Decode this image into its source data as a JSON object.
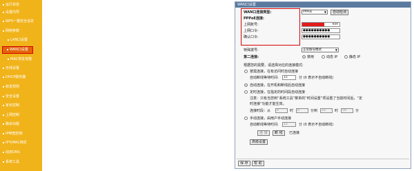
{
  "sidebar": {
    "items": [
      {
        "label": "运行状态"
      },
      {
        "label": "设置向导"
      },
      {
        "label": "WPS一键安全设定"
      },
      {
        "label": "网络参数"
      },
      {
        "label": "LAN口设置"
      },
      {
        "label": "WAN口设置"
      },
      {
        "label": "MAC地址克隆"
      },
      {
        "label": "无线设置"
      },
      {
        "label": "DHCP服务器"
      },
      {
        "label": "转发规则"
      },
      {
        "label": "安全设置"
      },
      {
        "label": "家长控制"
      },
      {
        "label": "上网控制"
      },
      {
        "label": "路由功能"
      },
      {
        "label": "IP带宽控制"
      },
      {
        "label": "IP与MAC绑定"
      },
      {
        "label": "动态DNS"
      },
      {
        "label": "系统工具"
      }
    ]
  },
  "panel": {
    "title": "WAN口设置",
    "conn_type_label": "WAN口连接类型:",
    "conn_type_value": "PPPoE",
    "auto_detect_btn": "自动检测",
    "pppoe_heading": "PPPoE连接:",
    "account_label": "上网账号:",
    "account_value": "949",
    "password_label": "上网口令:",
    "password_value": "●●●●●●●●●●",
    "confirm_label": "确认口令:",
    "confirm_value": "●●●●●●●●●●",
    "special_dial_label": "特殊拨号:",
    "special_dial_value": "正常拨号模式",
    "second_conn_label": "第二连接:",
    "disabled_label": "禁用",
    "dynamic_ip_label": "动态 IP",
    "static_ip_label": "静态 IP",
    "mode_intro": "根据您的需要，请选择对应的连接模式:",
    "on_demand_label": "按需连接，在有访问时自动连接",
    "idle_label_1": "自动断线等待时间:",
    "idle_value_1": "15",
    "idle_hint_1": "分 (0 表示不自动断线)",
    "auto_connect_label": "自动连接，在开机和断线后自动连接",
    "timed_connect_label": "定时连接，在指定的时间段自动连接",
    "timed_note_1": "注意：只有当您到“系统工具”菜单的“时间设置”项设置了当前时间后，“定",
    "timed_note_2": "时连接”功能才能生效。",
    "timed_period_label": "连接时段：从",
    "time_from_h": "0",
    "unit_hour": "时",
    "time_from_m": "0",
    "unit_min_to": "分到",
    "time_to_h": "23",
    "time_to_m": "59",
    "unit_min": "分",
    "manual_label": "手动连接，由用户手动连接",
    "idle_label_2": "自动断线等待时间:",
    "idle_value_2": "15",
    "idle_hint_2": "分 (0 表示不自动断线)",
    "connect_btn": "连 接",
    "disconnect_btn": "断 线",
    "status_text": "已连接",
    "advanced_btn": "高级设置",
    "save_btn": "保 存",
    "help_btn": "帮 助"
  },
  "colors": {
    "sidebar_bg": "#f1b31a",
    "sidebar_active": "#e4640b",
    "titlebar_bg": "#5b7a9f",
    "highlight_red": "#d40000"
  }
}
